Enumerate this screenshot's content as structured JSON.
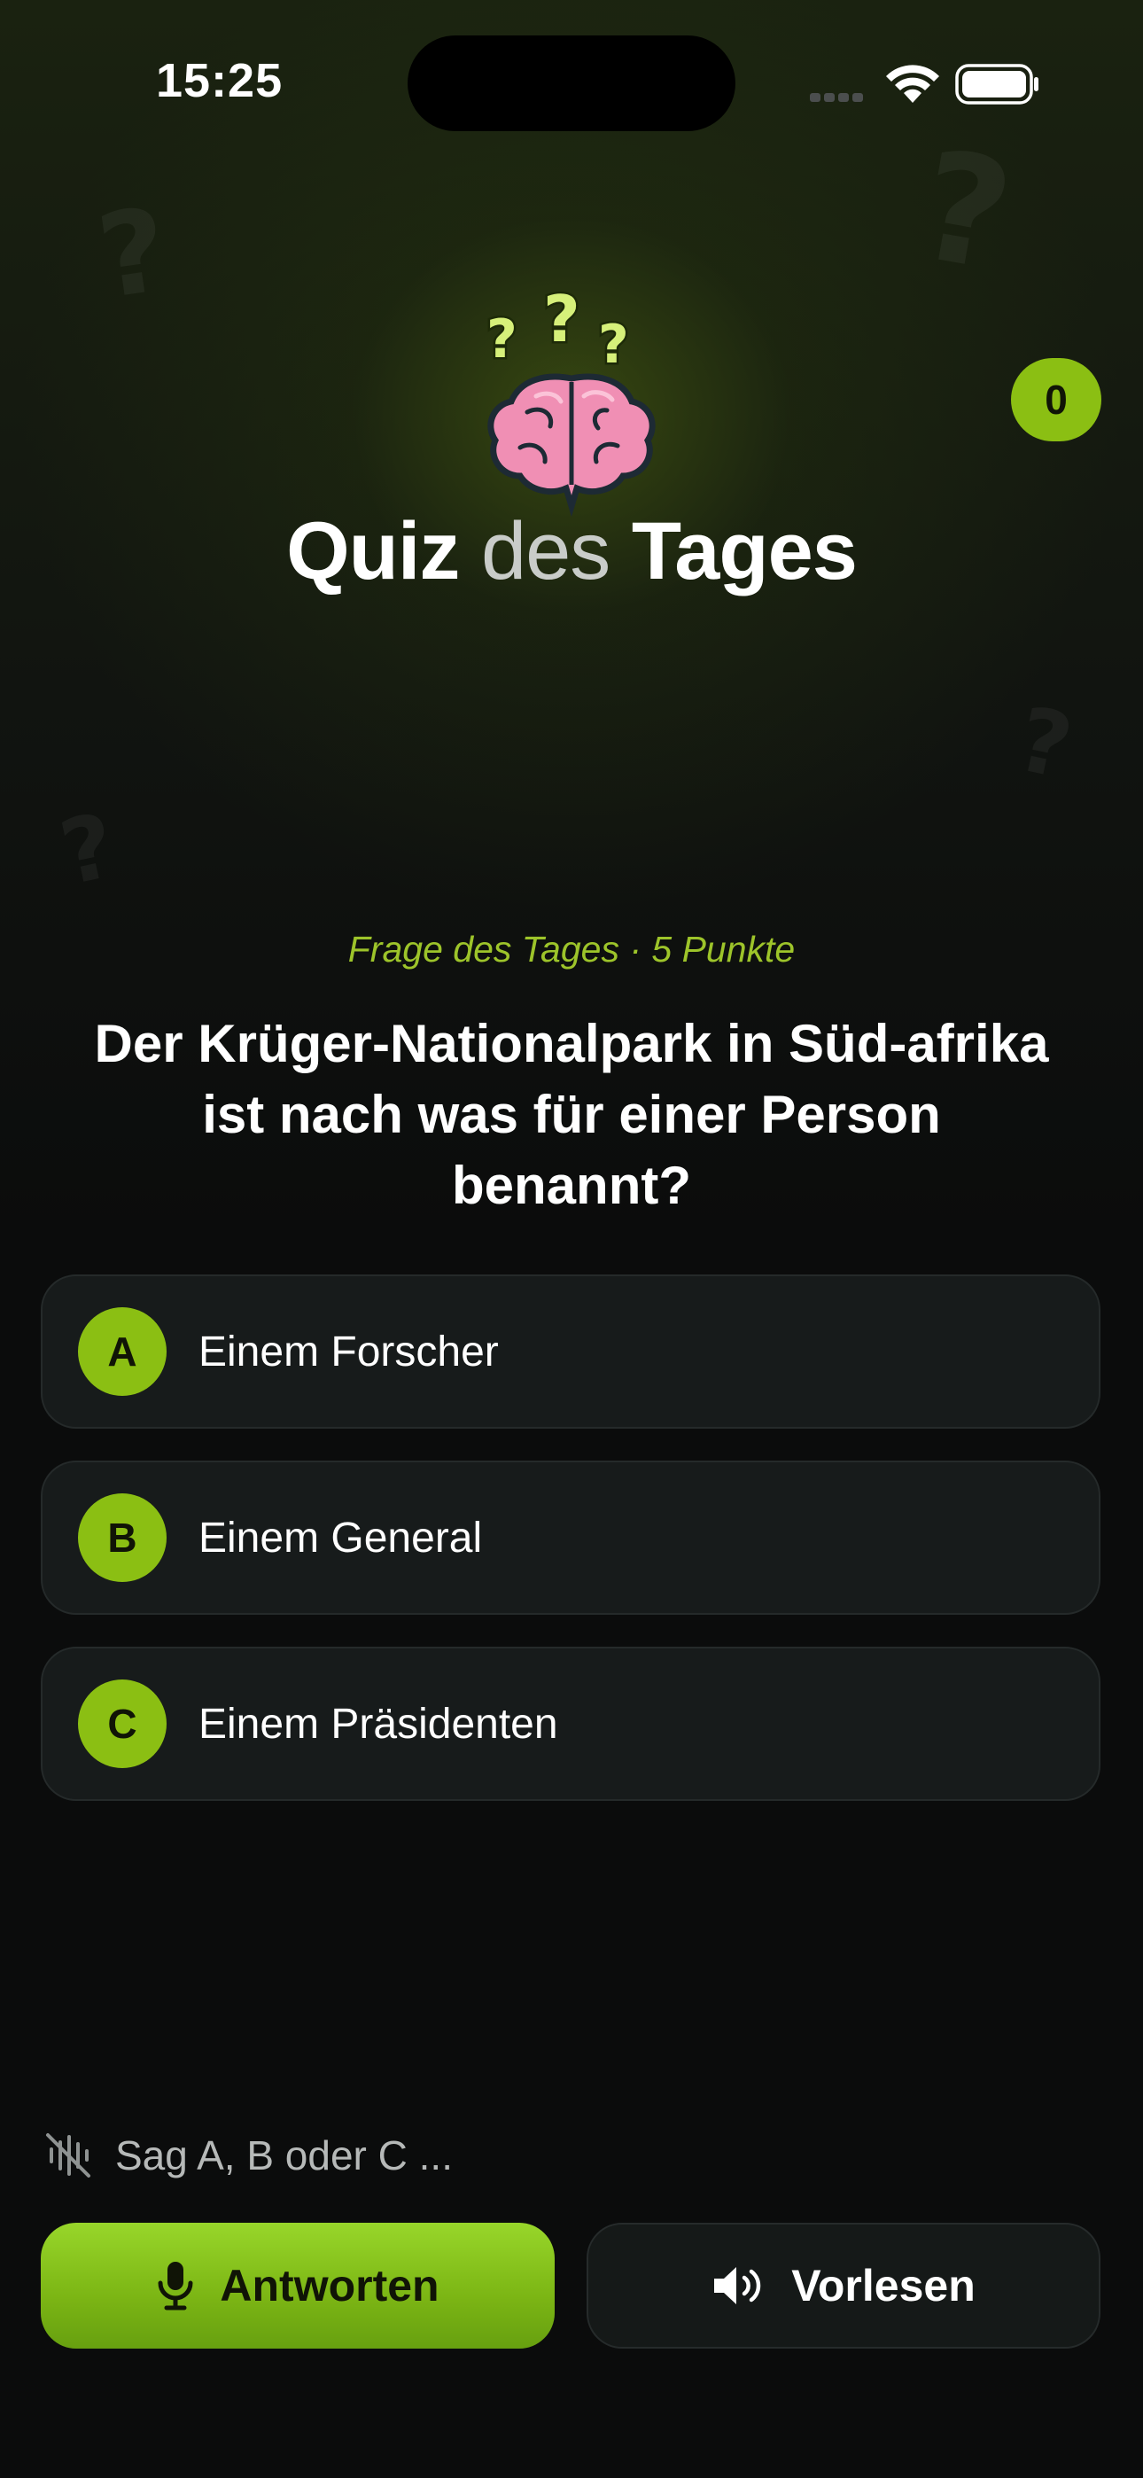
{
  "status_bar": {
    "time": "15:25"
  },
  "header": {
    "title_part1": "Quiz",
    "title_part2": "des",
    "title_part3": "Tages",
    "score": "0"
  },
  "question": {
    "meta": "Frage des Tages · 5 Punkte",
    "text": "Der Krüger-Nationalpark in Süd-afrika ist nach was für einer Person benannt?"
  },
  "answers": [
    {
      "letter": "A",
      "text": "Einem Forscher"
    },
    {
      "letter": "B",
      "text": "Einem General"
    },
    {
      "letter": "C",
      "text": "Einem Präsidenten"
    }
  ],
  "voice": {
    "hint": "Sag A, B oder C ..."
  },
  "buttons": {
    "answer_label": "Antworten",
    "read_label": "Vorlesen"
  },
  "icons": {
    "hero": "brain-question-icon",
    "answer_button": "microphone-icon",
    "read_button": "speaker-icon",
    "hint": "voice-off-icon"
  },
  "colors": {
    "accent": "#8bbf13",
    "background": "#0b0c0c",
    "meta": "#9dc42a"
  }
}
